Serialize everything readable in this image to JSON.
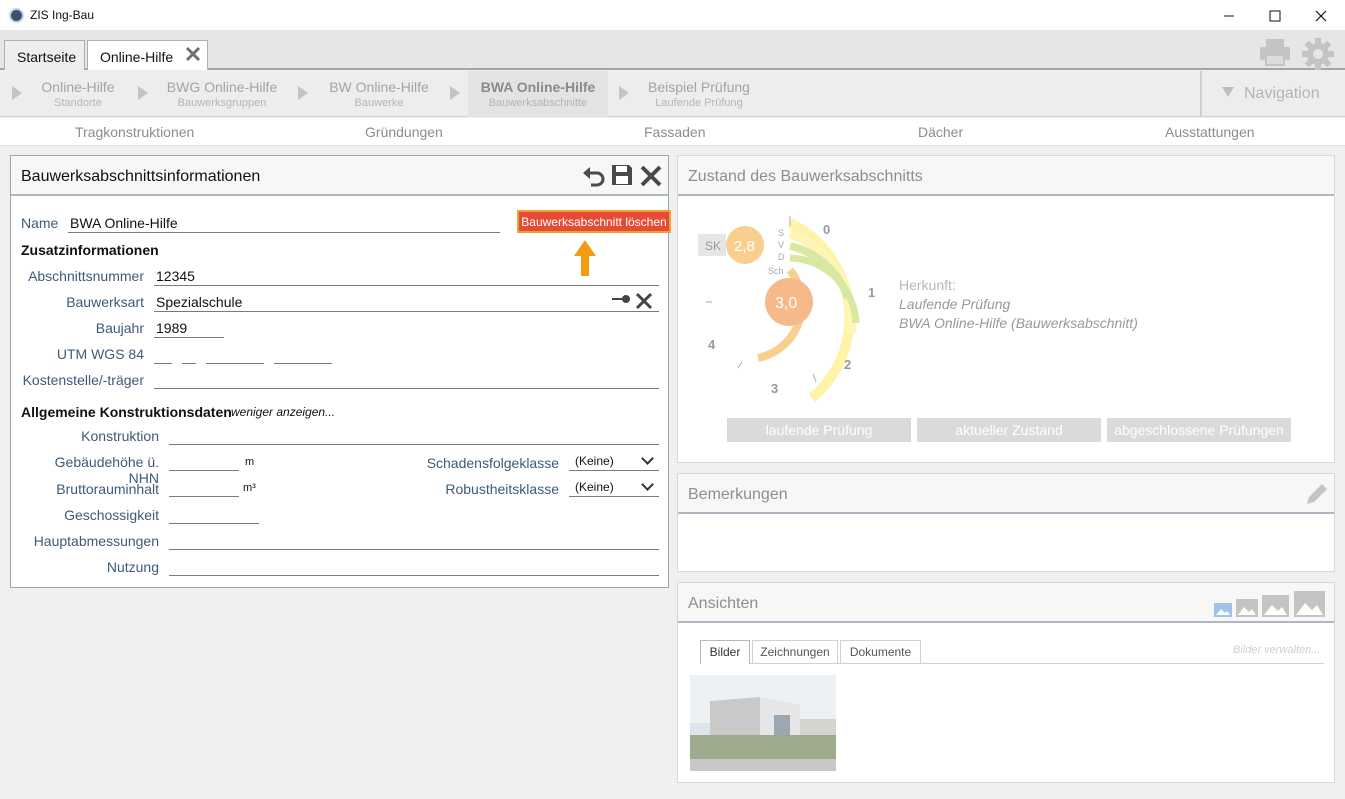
{
  "window": {
    "title": "ZIS Ing-Bau"
  },
  "tabs": [
    {
      "label": "Startseite"
    },
    {
      "label": "Online-Hilfe"
    }
  ],
  "breadcrumbs": [
    {
      "title": "Online-Hilfe",
      "sub": "Standorte"
    },
    {
      "title": "BWG Online-Hilfe",
      "sub": "Bauwerksgruppen"
    },
    {
      "title": "BW Online-Hilfe",
      "sub": "Bauwerke"
    },
    {
      "title": "BWA Online-Hilfe",
      "sub": "Bauwerksabschnitte"
    },
    {
      "title": "Beispiel Prüfung",
      "sub": "Laufende Prüfung"
    }
  ],
  "navigation_label": "Navigation",
  "categories": [
    "Tragkonstruktionen",
    "Gründungen",
    "Fassaden",
    "Dächer",
    "Ausstattungen"
  ],
  "info_panel": {
    "title": "Bauwerksabschnittsinformationen",
    "name_label": "Name",
    "name_value": "BWA Online-Hilfe",
    "delete_button": "Bauwerksabschnitt löschen",
    "zusatz_title": "Zusatzinformationen",
    "abschnittsnummer_label": "Abschnittsnummer",
    "abschnittsnummer_value": "12345",
    "bauwerksart_label": "Bauwerksart",
    "bauwerksart_value": "Spezialschule",
    "baujahr_label": "Baujahr",
    "baujahr_value": "1989",
    "utm_label": "UTM WGS 84",
    "kosten_label": "Kostenstelle/-träger",
    "allg_title": "Allgemeine Konstruktionsdaten",
    "weniger_label": "weniger anzeigen...",
    "konstruktion_label": "Konstruktion",
    "gebaeudehoehe_label": "Gebäudehöhe ü. NHN",
    "gebaeudehoehe_unit": "m",
    "brutto_label": "Bruttorauminhalt",
    "brutto_unit": "m³",
    "geschoss_label": "Geschossigkeit",
    "haupt_label": "Hauptabmessungen",
    "nutzung_label": "Nutzung",
    "schadensfolge_label": "Schadensfolgeklasse",
    "schadensfolge_value": "(Keine)",
    "robustheit_label": "Robustheitsklasse",
    "robustheit_value": "(Keine)"
  },
  "state_panel": {
    "title": "Zustand des Bauwerksabschnitts",
    "sk_label": "SK",
    "sk_value": "2,8",
    "main_value": "3,0",
    "ring_labels": [
      "S",
      "V",
      "D",
      "Sch"
    ],
    "scale_labels": [
      "0",
      "1",
      "2",
      "3",
      "4"
    ],
    "herkunft_label": "Herkunft:",
    "herkunft_line1": "Laufende Prüfung",
    "herkunft_line2": "BWA Online-Hilfe (Bauwerksabschnitt)",
    "buttons": [
      "laufende Prüfung",
      "aktueller Zustand",
      "abgeschlossene Prüfungen"
    ]
  },
  "remarks_panel": {
    "title": "Bemerkungen"
  },
  "views_panel": {
    "title": "Ansichten",
    "tabs": [
      "Bilder",
      "Zeichnungen",
      "Dokumente"
    ],
    "manage_label": "Bilder verwalten..."
  },
  "colors": {
    "accent_delete": "#e64b36",
    "arrow": "#f39c12",
    "ring_yellow": "#fff3a8",
    "ring_green": "#d8e8a0",
    "ring_orange": "#f8cf8f"
  }
}
